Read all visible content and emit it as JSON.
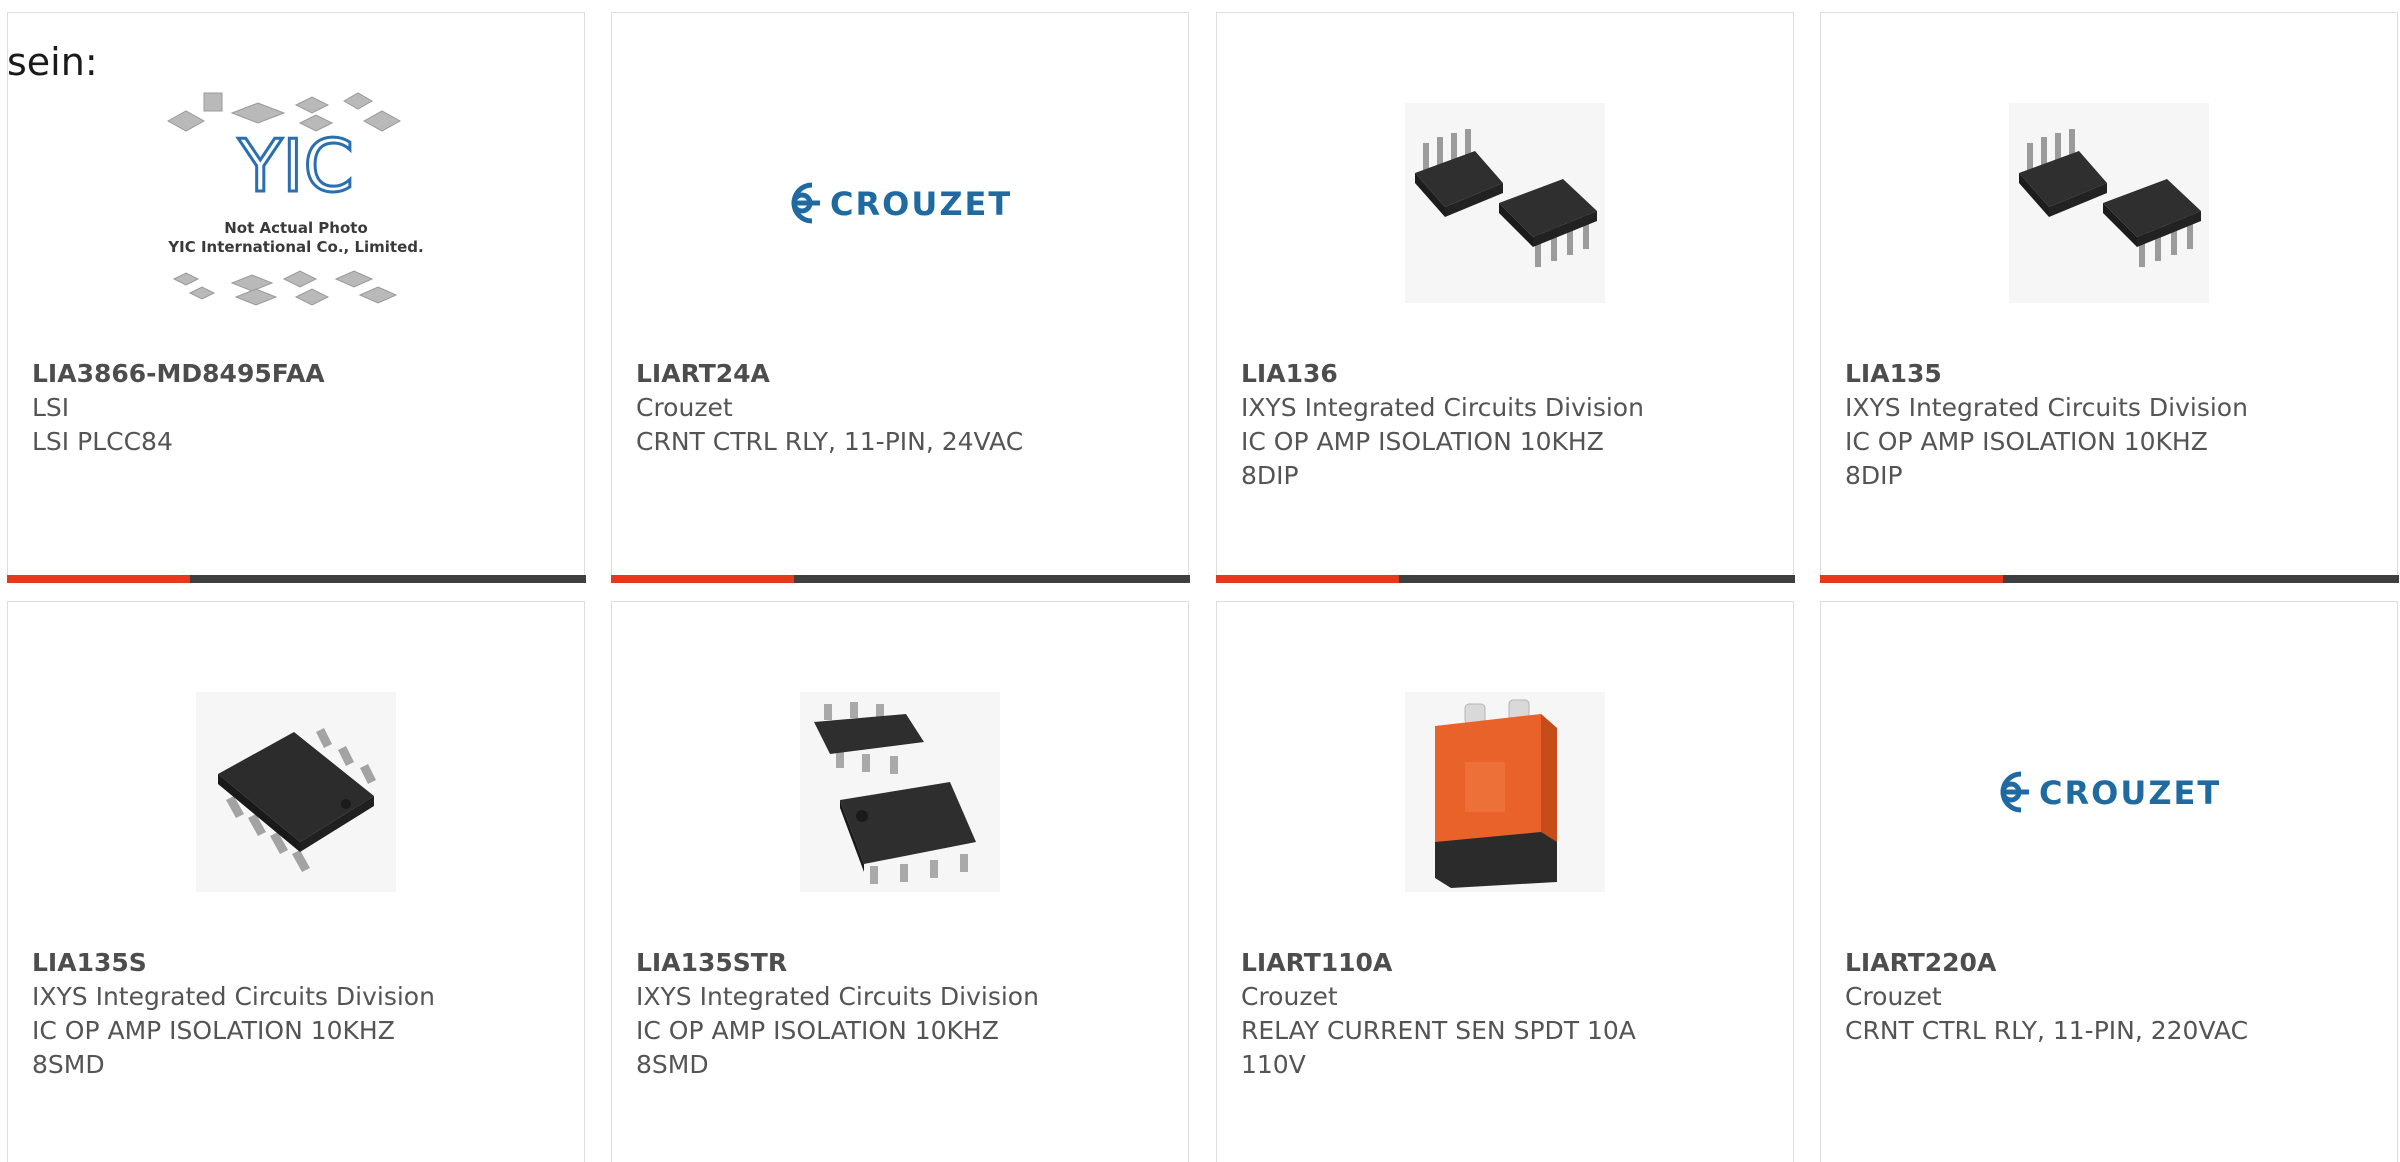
{
  "lead_text": "sein:",
  "yic_placeholder": {
    "logo": "YIC",
    "line1": "Not Actual Photo",
    "line2": "YIC International Co., Limited."
  },
  "crouzet_logo": "CROUZET",
  "colors": {
    "accent": "#e8381a",
    "bar": "#3f3f3f",
    "border": "#dedede",
    "text": "#545454",
    "crouzet_blue": "#1f6aa1",
    "relay_orange": "#e8622a"
  },
  "products": [
    {
      "part": "LIA3866-MD8495FAA",
      "maker": "LSI",
      "desc1": "LSI PLCC84",
      "desc2": "",
      "image": "yic-placeholder"
    },
    {
      "part": "LIART24A",
      "maker": "Crouzet",
      "desc1": "CRNT CTRL RLY, 11-PIN, 24VAC",
      "desc2": "",
      "image": "crouzet-logo"
    },
    {
      "part": "LIA136",
      "maker": "IXYS Integrated Circuits Division",
      "desc1": "IC OP AMP ISOLATION 10KHZ",
      "desc2": "8DIP",
      "image": "dip-chips"
    },
    {
      "part": "LIA135",
      "maker": "IXYS Integrated Circuits Division",
      "desc1": "IC OP AMP ISOLATION 10KHZ",
      "desc2": "8DIP",
      "image": "dip-chips"
    },
    {
      "part": "LIA135S",
      "maker": "IXYS Integrated Circuits Division",
      "desc1": "IC OP AMP ISOLATION 10KHZ",
      "desc2": "8SMD",
      "image": "smd-chip"
    },
    {
      "part": "LIA135STR",
      "maker": "IXYS Integrated Circuits Division",
      "desc1": "IC OP AMP ISOLATION 10KHZ",
      "desc2": "8SMD",
      "image": "smd-chips"
    },
    {
      "part": "LIART110A",
      "maker": "Crouzet",
      "desc1": "RELAY CURRENT SEN SPDT 10A",
      "desc2": "110V",
      "image": "relay-module"
    },
    {
      "part": "LIART220A",
      "maker": "Crouzet",
      "desc1": "CRNT CTRL RLY, 11-PIN, 220VAC",
      "desc2": "",
      "image": "crouzet-logo"
    }
  ]
}
